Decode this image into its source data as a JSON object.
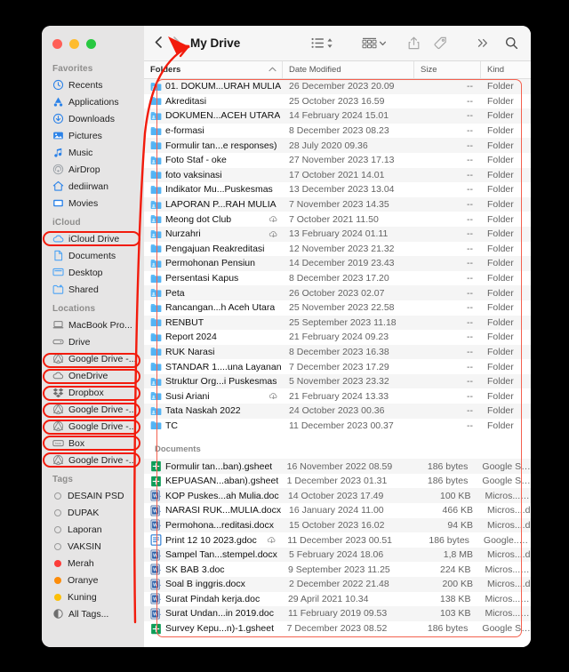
{
  "window": {
    "title": "My Drive",
    "traffic_lights": [
      "close",
      "minimize",
      "zoom"
    ],
    "back_label": "‹",
    "forward_label": "›"
  },
  "toolbar": {
    "view_icon": "list-view-icon",
    "view_chevron": "chevron-up-down-icon",
    "group_icon": "group-by-icon",
    "group_chevron": "chevron-down-icon",
    "share_icon": "share-icon",
    "tag_icon": "tag-icon",
    "more_icon": "more-chevrons-icon",
    "more_label": "»",
    "search_icon": "search-icon"
  },
  "columns": {
    "name": "Folders",
    "date": "Date Modified",
    "size": "Size",
    "kind": "Kind",
    "sort_caret": "⌃"
  },
  "sidebar": {
    "sections": [
      {
        "heading": "Favorites",
        "items": [
          {
            "label": "Recents",
            "icon": "clock-icon",
            "highlighted": false
          },
          {
            "label": "Applications",
            "icon": "applications-icon",
            "highlighted": false
          },
          {
            "label": "Downloads",
            "icon": "downloads-icon",
            "highlighted": false
          },
          {
            "label": "Pictures",
            "icon": "pictures-icon",
            "highlighted": false
          },
          {
            "label": "Music",
            "icon": "music-note-icon",
            "highlighted": false
          },
          {
            "label": "AirDrop",
            "icon": "airdrop-icon",
            "highlighted": false
          },
          {
            "label": "dediirwan",
            "icon": "home-icon",
            "highlighted": false
          },
          {
            "label": "Movies",
            "icon": "movies-icon",
            "highlighted": false
          }
        ]
      },
      {
        "heading": "iCloud",
        "items": [
          {
            "label": "iCloud Drive",
            "icon": "icloud-icon",
            "highlighted": true
          },
          {
            "label": "Documents",
            "icon": "document-icon",
            "highlighted": false
          },
          {
            "label": "Desktop",
            "icon": "desktop-icon",
            "highlighted": false
          },
          {
            "label": "Shared",
            "icon": "shared-folder-icon",
            "highlighted": false
          }
        ]
      },
      {
        "heading": "Locations",
        "items": [
          {
            "label": "MacBook Pro...",
            "icon": "laptop-icon",
            "highlighted": false
          },
          {
            "label": "Drive",
            "icon": "disk-icon",
            "highlighted": false
          },
          {
            "label": "Google Drive -...",
            "icon": "google-drive-icon",
            "highlighted": true
          },
          {
            "label": "OneDrive",
            "icon": "onedrive-cloud-icon",
            "highlighted": true
          },
          {
            "label": "Dropbox",
            "icon": "dropbox-icon",
            "highlighted": true
          },
          {
            "label": "Google Drive -...",
            "icon": "google-drive-icon",
            "highlighted": true
          },
          {
            "label": "Google Drive -...",
            "icon": "google-drive-icon",
            "highlighted": true
          },
          {
            "label": "Box",
            "icon": "box-icon",
            "highlighted": true
          },
          {
            "label": "Google Drive -...",
            "icon": "google-drive-icon",
            "highlighted": true
          }
        ]
      },
      {
        "heading": "Tags",
        "items": [
          {
            "label": "DESAIN PSD",
            "icon": "tag-dot-none",
            "color": "",
            "highlighted": false
          },
          {
            "label": "DUPAK",
            "icon": "tag-dot-none",
            "color": "",
            "highlighted": false
          },
          {
            "label": "Laporan",
            "icon": "tag-dot-none",
            "color": "",
            "highlighted": false
          },
          {
            "label": "VAKSIN",
            "icon": "tag-dot-none",
            "color": "",
            "highlighted": false
          },
          {
            "label": "Merah",
            "icon": "tag-dot",
            "color": "#fc3d39",
            "highlighted": false
          },
          {
            "label": "Oranye",
            "icon": "tag-dot",
            "color": "#fc8c0a",
            "highlighted": false
          },
          {
            "label": "Kuning",
            "icon": "tag-dot",
            "color": "#fcc009",
            "highlighted": false
          },
          {
            "label": "All Tags...",
            "icon": "all-tags-icon",
            "color": "",
            "highlighted": false
          }
        ]
      }
    ]
  },
  "groups": [
    {
      "label": "Folders",
      "show_label": false,
      "rows": [
        {
          "name": "01. DOKUM...URAH MULIA",
          "icon": "shared-folder-icon",
          "date": "26 December 2023 20.09",
          "size": "--",
          "kind": "Folder",
          "cloud": false
        },
        {
          "name": "Akreditasi",
          "icon": "folder-icon",
          "date": "25 October 2023 16.59",
          "size": "--",
          "kind": "Folder",
          "cloud": false
        },
        {
          "name": "DOKUMEN...ACEH UTARA",
          "icon": "shared-folder-icon",
          "date": "14 February 2024 15.01",
          "size": "--",
          "kind": "Folder",
          "cloud": false
        },
        {
          "name": "e-formasi",
          "icon": "folder-icon",
          "date": "8 December 2023 08.23",
          "size": "--",
          "kind": "Folder",
          "cloud": false
        },
        {
          "name": "Formulir tan...e responses)",
          "icon": "folder-icon",
          "date": "28 July 2020 09.36",
          "size": "--",
          "kind": "Folder",
          "cloud": false
        },
        {
          "name": "Foto Staf - oke",
          "icon": "shared-folder-icon",
          "date": "27 November 2023 17.13",
          "size": "--",
          "kind": "Folder",
          "cloud": false
        },
        {
          "name": "foto vaksinasi",
          "icon": "folder-icon",
          "date": "17 October 2021 14.01",
          "size": "--",
          "kind": "Folder",
          "cloud": false
        },
        {
          "name": "Indikator Mu...Puskesmas",
          "icon": "folder-icon",
          "date": "13 December 2023 13.04",
          "size": "--",
          "kind": "Folder",
          "cloud": false
        },
        {
          "name": "LAPORAN P...RAH MULIA",
          "icon": "shared-folder-icon",
          "date": "7 November 2023 14.35",
          "size": "--",
          "kind": "Folder",
          "cloud": false
        },
        {
          "name": "Meong dot Club",
          "icon": "shared-folder-icon",
          "date": "7 October 2021 11.50",
          "size": "--",
          "kind": "Folder",
          "cloud": true
        },
        {
          "name": "Nurzahri",
          "icon": "shared-folder-icon",
          "date": "13 February 2024 01.11",
          "size": "--",
          "kind": "Folder",
          "cloud": true
        },
        {
          "name": "Pengajuan Reakreditasi",
          "icon": "folder-icon",
          "date": "12 November 2023 21.32",
          "size": "--",
          "kind": "Folder",
          "cloud": false
        },
        {
          "name": "Permohonan Pensiun",
          "icon": "shared-folder-icon",
          "date": "14 December 2019 23.43",
          "size": "--",
          "kind": "Folder",
          "cloud": false
        },
        {
          "name": "Persentasi Kapus",
          "icon": "folder-icon",
          "date": "8 December 2023 17.20",
          "size": "--",
          "kind": "Folder",
          "cloud": false
        },
        {
          "name": "Peta",
          "icon": "shared-folder-icon",
          "date": "26 October 2023 02.07",
          "size": "--",
          "kind": "Folder",
          "cloud": false
        },
        {
          "name": "Rancangan...h Aceh Utara",
          "icon": "folder-icon",
          "date": "25 November 2023 22.58",
          "size": "--",
          "kind": "Folder",
          "cloud": false
        },
        {
          "name": "RENBUT",
          "icon": "folder-icon",
          "date": "25 September 2023 11.18",
          "size": "--",
          "kind": "Folder",
          "cloud": false
        },
        {
          "name": "Report 2024",
          "icon": "folder-icon",
          "date": "21 February 2024 09.23",
          "size": "--",
          "kind": "Folder",
          "cloud": false
        },
        {
          "name": "RUK Narasi",
          "icon": "folder-icon",
          "date": "8 December 2023 16.38",
          "size": "--",
          "kind": "Folder",
          "cloud": false
        },
        {
          "name": "STANDAR 1....una Layanan",
          "icon": "folder-icon",
          "date": "7 December 2023 17.29",
          "size": "--",
          "kind": "Folder",
          "cloud": false
        },
        {
          "name": "Struktur Org...i Puskesmas",
          "icon": "shared-folder-icon",
          "date": "5 November 2023 23.32",
          "size": "--",
          "kind": "Folder",
          "cloud": false
        },
        {
          "name": "Susi Ariani",
          "icon": "shared-folder-icon",
          "date": "21 February 2024 13.33",
          "size": "--",
          "kind": "Folder",
          "cloud": true
        },
        {
          "name": "Tata Naskah 2022",
          "icon": "shared-folder-icon",
          "date": "24 October 2023 00.36",
          "size": "--",
          "kind": "Folder",
          "cloud": false
        },
        {
          "name": "TC",
          "icon": "folder-icon",
          "date": "11 December 2023 00.37",
          "size": "--",
          "kind": "Folder",
          "cloud": false
        }
      ]
    },
    {
      "label": "Documents",
      "show_label": true,
      "rows": [
        {
          "name": "Formulir tan...ban).gsheet",
          "icon": "gsheet-icon",
          "date": "16 November 2022 08.59",
          "size": "186 bytes",
          "kind": "Google She",
          "cloud": false
        },
        {
          "name": "KEPUASAN...aban).gsheet",
          "icon": "gsheet-icon",
          "date": "1 December 2023 01.31",
          "size": "186 bytes",
          "kind": "Google She",
          "cloud": false
        },
        {
          "name": "KOP Puskes...ah Mulia.doc",
          "icon": "word-doc-icon",
          "date": "14 October 2023 17.49",
          "size": "100 KB",
          "kind": "Micros...t (.",
          "cloud": false
        },
        {
          "name": "NARASI RUK...MULIA.docx",
          "icon": "word-docx-icon",
          "date": "16 January 2024 11.00",
          "size": "466 KB",
          "kind": "Micros....d",
          "cloud": false
        },
        {
          "name": "Permohona...reditasi.docx",
          "icon": "word-docx-icon",
          "date": "15 October 2023 16.02",
          "size": "94 KB",
          "kind": "Micros....d",
          "cloud": false
        },
        {
          "name": "Print  12 10 2023.gdoc",
          "icon": "gdoc-icon",
          "date": "11 December 2023 00.51",
          "size": "186 bytes",
          "kind": "Google...cu",
          "cloud": true
        },
        {
          "name": "Sampel Tan...stempel.docx",
          "icon": "word-docx-icon",
          "date": "5 February 2024 18.06",
          "size": "1,8 MB",
          "kind": "Micros....d",
          "cloud": false
        },
        {
          "name": "SK BAB 3.doc",
          "icon": "word-doc-icon",
          "date": "9 September 2023 11.25",
          "size": "224 KB",
          "kind": "Micros...t (.",
          "cloud": false
        },
        {
          "name": "Soal B inggris.docx",
          "icon": "word-docx-icon",
          "date": "2 December 2022 21.48",
          "size": "200 KB",
          "kind": "Micros....d",
          "cloud": false
        },
        {
          "name": "Surat Pindah kerja.doc",
          "icon": "word-doc-icon",
          "date": "29 April 2021 10.34",
          "size": "138 KB",
          "kind": "Micros...t (.",
          "cloud": false
        },
        {
          "name": "Surat Undan...in 2019.doc",
          "icon": "word-doc-icon",
          "date": "11 February 2019 09.53",
          "size": "103 KB",
          "kind": "Micros...t (.",
          "cloud": false
        },
        {
          "name": "Survey Kepu...n)-1.gsheet",
          "icon": "gsheet-icon",
          "date": "7 December 2023 08.52",
          "size": "186 bytes",
          "kind": "Google She",
          "cloud": false
        }
      ]
    }
  ],
  "annotations": {
    "arrow_color": "#f21b0c",
    "outline_color": "#f4614f",
    "arrow_target": "My Drive",
    "highlighted_sidebar_items": [
      "iCloud Drive",
      "Google Drive -...",
      "OneDrive",
      "Dropbox",
      "Google Drive -...",
      "Google Drive -...",
      "Box",
      "Google Drive -..."
    ]
  }
}
